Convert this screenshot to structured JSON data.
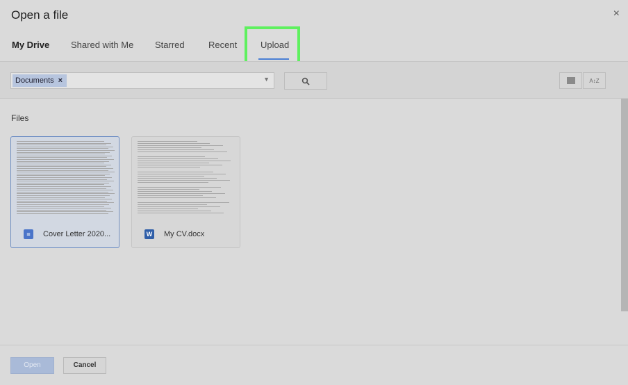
{
  "dialog": {
    "title": "Open a file",
    "close_label": "×"
  },
  "tabs": [
    {
      "label": "My Drive",
      "active": true
    },
    {
      "label": "Shared with Me",
      "active": false
    },
    {
      "label": "Starred",
      "active": false
    },
    {
      "label": "Recent",
      "active": false
    },
    {
      "label": "Upload",
      "active": false,
      "highlighted": true
    }
  ],
  "search": {
    "chip_label": "Documents",
    "chip_remove": "×",
    "caret": "▼",
    "search_icon": "search-icon"
  },
  "view_buttons": [
    {
      "icon": "list-view-icon"
    },
    {
      "icon": "sort-az-icon",
      "label": "A↕Z"
    }
  ],
  "files_section": {
    "label": "Files"
  },
  "files": [
    {
      "name": "Cover Letter 2020...",
      "type": "google-doc",
      "icon_glyph": "≡",
      "icon_color": "#4a74c9",
      "selected": true
    },
    {
      "name": "My CV.docx",
      "type": "word",
      "icon_glyph": "W",
      "icon_color": "#2f5ea8",
      "selected": false
    }
  ],
  "footer": {
    "open_label": "Open",
    "cancel_label": "Cancel"
  },
  "colors": {
    "highlight": "#5ef05e",
    "accent": "#4a7fd4"
  }
}
